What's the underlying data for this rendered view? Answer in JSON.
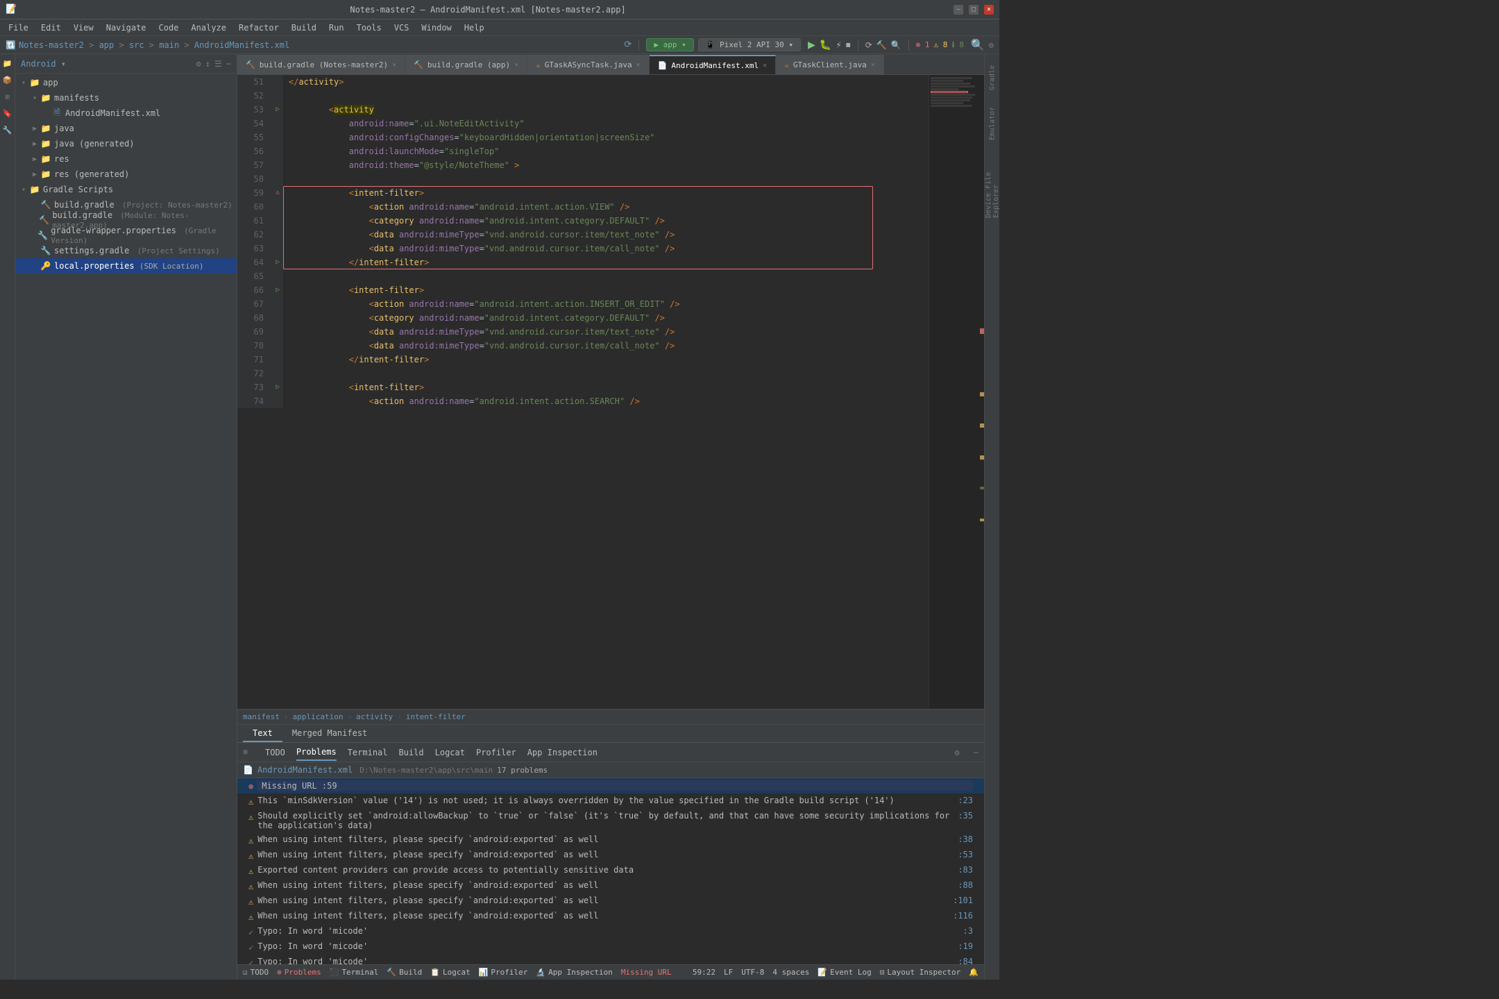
{
  "titleBar": {
    "title": "Notes-master2 – AndroidManifest.xml [Notes-master2.app]",
    "minLabel": "—",
    "maxLabel": "□",
    "closeLabel": "✕"
  },
  "menuBar": {
    "items": [
      "File",
      "Edit",
      "View",
      "Navigate",
      "Code",
      "Analyze",
      "Refactor",
      "Build",
      "Run",
      "Tools",
      "VCS",
      "Window",
      "Help"
    ]
  },
  "navBar": {
    "breadcrumb": "Notes-master2 > app > src > main > AndroidManifest.xml",
    "parts": [
      "Notes-master2",
      "app",
      "src",
      "main",
      "AndroidManifest.xml"
    ]
  },
  "appToolbar": {
    "appDropdown": "▶  app",
    "deviceDropdown": "Pixel 2 API 30",
    "runLabel": "▶",
    "debugLabel": "🐛",
    "errorCount": "1",
    "warningCount": "8",
    "infoCount": "8"
  },
  "sidebar": {
    "header": "Android",
    "tree": [
      {
        "id": "app",
        "label": "app",
        "icon": "📁",
        "indent": 0,
        "arrow": "▾",
        "selected": false
      },
      {
        "id": "manifests",
        "label": "manifests",
        "icon": "📁",
        "indent": 1,
        "arrow": "▾",
        "selected": false
      },
      {
        "id": "androidmanifest",
        "label": "AndroidManifest.xml",
        "icon": "🗎",
        "indent": 2,
        "arrow": "",
        "selected": false
      },
      {
        "id": "java",
        "label": "java",
        "icon": "📁",
        "indent": 1,
        "arrow": "▶",
        "selected": false
      },
      {
        "id": "java-gen",
        "label": "java (generated)",
        "icon": "📁",
        "indent": 1,
        "arrow": "▶",
        "selected": false
      },
      {
        "id": "res",
        "label": "res",
        "icon": "📁",
        "indent": 1,
        "arrow": "▶",
        "selected": false
      },
      {
        "id": "res-gen",
        "label": "res (generated)",
        "icon": "📁",
        "indent": 1,
        "arrow": "▶",
        "selected": false
      },
      {
        "id": "gradle-scripts",
        "label": "Gradle Scripts",
        "icon": "📁",
        "indent": 0,
        "arrow": "▾",
        "selected": false
      },
      {
        "id": "build-gradle-proj",
        "label": "build.gradle",
        "sub": "(Project: Notes-master2)",
        "icon": "🔨",
        "indent": 1,
        "arrow": "",
        "selected": false
      },
      {
        "id": "build-gradle-app",
        "label": "build.gradle",
        "sub": "(Module: Notes-master2.app)",
        "icon": "🔨",
        "indent": 1,
        "arrow": "",
        "selected": false
      },
      {
        "id": "gradle-wrapper",
        "label": "gradle-wrapper.properties",
        "sub": "(Gradle Version)",
        "icon": "🔧",
        "indent": 1,
        "arrow": "",
        "selected": false
      },
      {
        "id": "settings-gradle",
        "label": "settings.gradle",
        "sub": "(Project Settings)",
        "icon": "🔧",
        "indent": 1,
        "arrow": "",
        "selected": false
      },
      {
        "id": "local-properties",
        "label": "local.properties",
        "sub": "(SDK Location)",
        "icon": "🔑",
        "indent": 1,
        "arrow": "",
        "selected": true
      }
    ]
  },
  "tabs": [
    {
      "label": "build.gradle (Notes-master2)",
      "icon": "🔨",
      "active": false
    },
    {
      "label": "build.gradle (app)",
      "icon": "🔨",
      "active": false
    },
    {
      "label": "GTaskASyncTask.java",
      "icon": "☕",
      "active": false
    },
    {
      "label": "AndroidManifest.xml",
      "icon": "📄",
      "active": true
    },
    {
      "label": "GTaskClient.java",
      "icon": "☕",
      "active": false
    }
  ],
  "codeLines": [
    {
      "num": 51,
      "gutter": "",
      "content": "        </activity>",
      "highlight": false,
      "error": false
    },
    {
      "num": 52,
      "gutter": "",
      "content": "",
      "highlight": false,
      "error": false
    },
    {
      "num": 53,
      "gutter": "",
      "content": "        <activity",
      "highlight": false,
      "error": false
    },
    {
      "num": 54,
      "gutter": "",
      "content": "            android:name=\".ui.NoteEditActivity\"",
      "highlight": false,
      "error": false
    },
    {
      "num": 55,
      "gutter": "",
      "content": "            android:configChanges=\"keyboardHidden|orientation|screenSize\"",
      "highlight": false,
      "error": false
    },
    {
      "num": 56,
      "gutter": "",
      "content": "            android:launchMode=\"singleTop\"",
      "highlight": false,
      "error": false
    },
    {
      "num": 57,
      "gutter": "",
      "content": "            android:theme=\"@style/NoteTheme\" >",
      "highlight": false,
      "error": false
    },
    {
      "num": 58,
      "gutter": "",
      "content": "",
      "highlight": false,
      "error": false
    },
    {
      "num": 59,
      "gutter": "⚠",
      "content": "            <intent-filter>",
      "highlight": false,
      "error": true
    },
    {
      "num": 60,
      "gutter": "",
      "content": "                <action android:name=\"android.intent.action.VIEW\" />",
      "highlight": false,
      "error": true
    },
    {
      "num": 61,
      "gutter": "",
      "content": "                <category android:name=\"android.intent.category.DEFAULT\" />",
      "highlight": false,
      "error": true
    },
    {
      "num": 62,
      "gutter": "",
      "content": "                <data android:mimeType=\"vnd.android.cursor.item/text_note\" />",
      "highlight": false,
      "error": true
    },
    {
      "num": 63,
      "gutter": "",
      "content": "                <data android:mimeType=\"vnd.android.cursor.item/call_note\" />",
      "highlight": false,
      "error": true
    },
    {
      "num": 64,
      "gutter": "",
      "content": "            </intent-filter>",
      "highlight": false,
      "error": true
    },
    {
      "num": 65,
      "gutter": "",
      "content": "",
      "highlight": false,
      "error": false
    },
    {
      "num": 66,
      "gutter": "",
      "content": "            <intent-filter>",
      "highlight": false,
      "error": false
    },
    {
      "num": 67,
      "gutter": "",
      "content": "                <action android:name=\"android.intent.action.INSERT_OR_EDIT\" />",
      "highlight": false,
      "error": false
    },
    {
      "num": 68,
      "gutter": "",
      "content": "                <category android:name=\"android.intent.category.DEFAULT\" />",
      "highlight": false,
      "error": false
    },
    {
      "num": 69,
      "gutter": "",
      "content": "                <data android:mimeType=\"vnd.android.cursor.item/text_note\" />",
      "highlight": false,
      "error": false
    },
    {
      "num": 70,
      "gutter": "",
      "content": "                <data android:mimeType=\"vnd.android.cursor.item/call_note\" />",
      "highlight": false,
      "error": false
    },
    {
      "num": 71,
      "gutter": "",
      "content": "            </intent-filter>",
      "highlight": false,
      "error": false
    },
    {
      "num": 72,
      "gutter": "",
      "content": "",
      "highlight": false,
      "error": false
    },
    {
      "num": 73,
      "gutter": "",
      "content": "            <intent-filter>",
      "highlight": false,
      "error": false
    },
    {
      "num": 74,
      "gutter": "",
      "content": "                <action android:name=\"android.intent.action.SEARCH\" />",
      "highlight": false,
      "error": false
    }
  ],
  "breadcrumb": {
    "parts": [
      "manifest",
      "application",
      "activity",
      "intent-filter"
    ]
  },
  "editorBottomTabs": [
    {
      "label": "Text",
      "active": true
    },
    {
      "label": "Merged Manifest",
      "active": false
    }
  ],
  "bottomPanel": {
    "tabs": [
      {
        "label": "TODO",
        "active": false,
        "badge": "",
        "badgeType": ""
      },
      {
        "label": "Problems",
        "active": true,
        "badge": "",
        "badgeType": ""
      },
      {
        "label": "Terminal",
        "active": false,
        "badge": "",
        "badgeType": ""
      },
      {
        "label": "Build",
        "active": false,
        "badge": "",
        "badgeType": ""
      },
      {
        "label": "Logcat",
        "active": false,
        "badge": "",
        "badgeType": ""
      },
      {
        "label": "Profiler",
        "active": false,
        "badge": "",
        "badgeType": ""
      },
      {
        "label": "App Inspection",
        "active": false,
        "badge": "",
        "badgeType": ""
      }
    ],
    "problems": {
      "filename": "AndroidManifest.xml",
      "path": "D:\\Notes-master2\\app\\src\\main",
      "count": "17 problems",
      "items": [
        {
          "type": "error",
          "text": "Missing URL :59",
          "selected": true
        },
        {
          "type": "warning",
          "text": "This `minSdkVersion` value ('14') is not used; it is always overridden by the value specified in the Gradle build script ('14') :23",
          "selected": false
        },
        {
          "type": "warning",
          "text": "Should explicitly set `android:allowBackup` to `true` or `false` (it's `true` by default, and that can have some security implications for the application's data) :35",
          "selected": false
        },
        {
          "type": "warning",
          "text": "When using intent filters, please specify `android:exported` as well :38",
          "selected": false
        },
        {
          "type": "warning",
          "text": "When using intent filters, please specify `android:exported` as well :53",
          "selected": false
        },
        {
          "type": "warning",
          "text": "Exported content providers can provide access to potentially sensitive data :83",
          "selected": false
        },
        {
          "type": "warning",
          "text": "When using intent filters, please specify `android:exported` as well :88",
          "selected": false
        },
        {
          "type": "warning",
          "text": "When using intent filters, please specify `android:exported` as well :101",
          "selected": false
        },
        {
          "type": "warning",
          "text": "When using intent filters, please specify `android:exported` as well :116",
          "selected": false
        },
        {
          "type": "typo",
          "text": "Typo: In word 'micode' :3",
          "selected": false
        },
        {
          "type": "typo",
          "text": "Typo: In word 'micode' :19",
          "selected": false
        },
        {
          "type": "typo",
          "text": "Typo: In word 'micode' :84",
          "selected": false
        }
      ]
    }
  },
  "statusBar": {
    "todo": "TODO",
    "errorIcon": "⊗",
    "errorText": "Problems",
    "terminal": "Terminal",
    "build": "Build",
    "logcat": "Logcat",
    "profiler": "Profiler",
    "appInspection": "App Inspection",
    "missingUrl": "Missing URL",
    "time": "59:22",
    "encoding": "LF  UTF-8",
    "indent": "4 spaces",
    "eventLog": "Event Log",
    "layoutInspector": "Layout Inspector",
    "line_col": "LF",
    "right_items": [
      "59:22",
      "LF",
      "UTF-8",
      "4 spaces"
    ]
  },
  "rightPanel": {
    "labels": [
      "Gradle",
      "Structure",
      "Favorites",
      "Build Variants",
      "Emulator",
      "Device File Explorer"
    ]
  }
}
